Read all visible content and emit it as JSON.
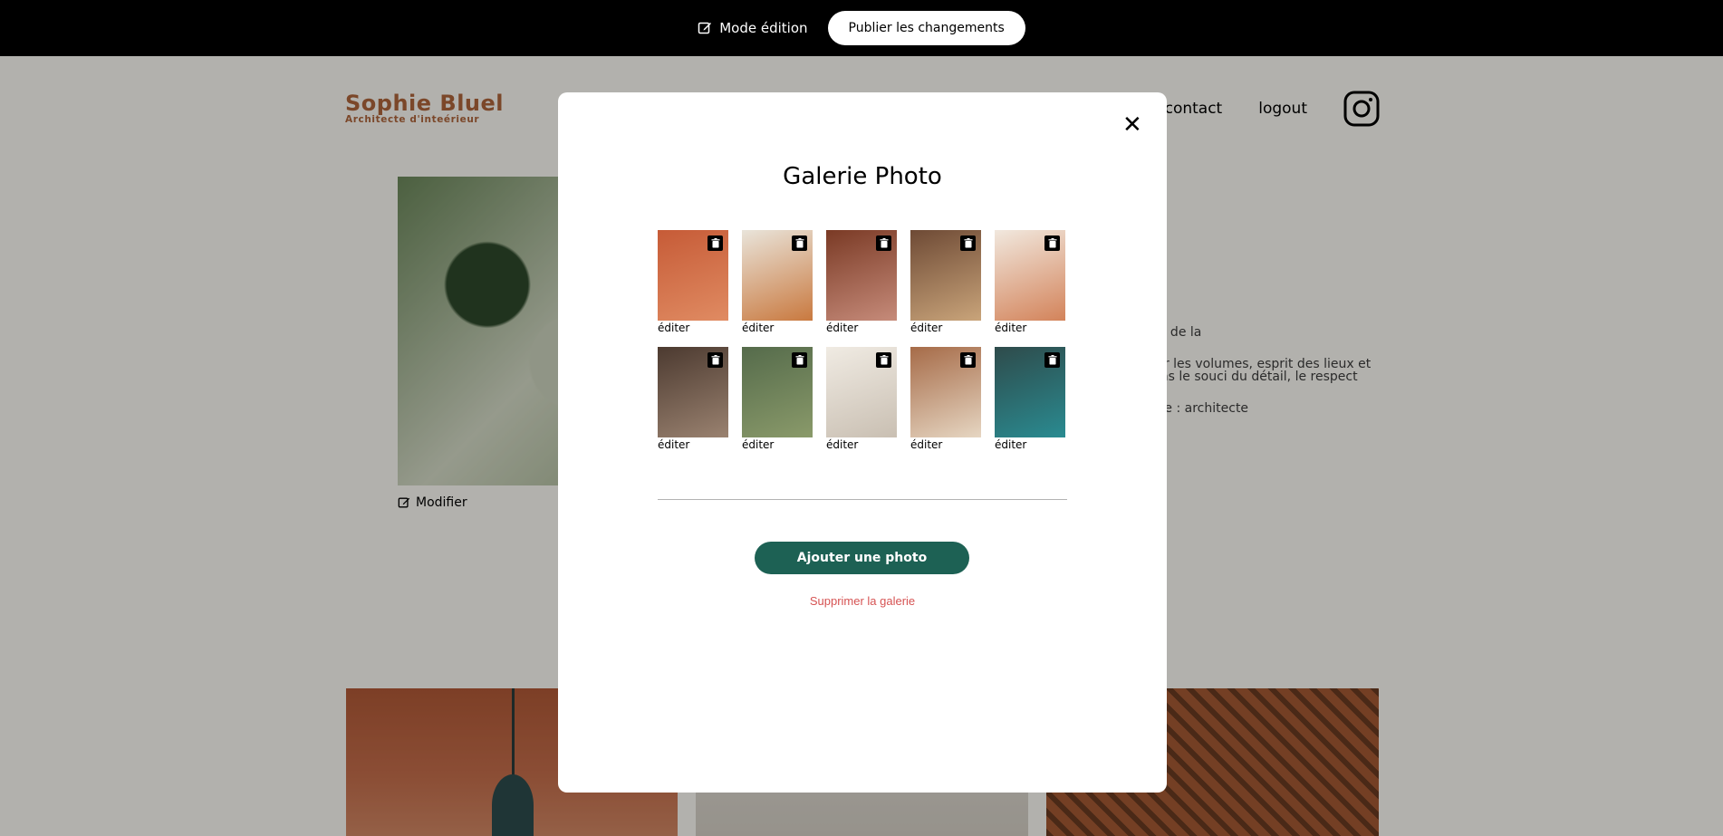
{
  "edit_bar": {
    "mode_label": "Mode édition",
    "publish_label": "Publier les changements"
  },
  "header": {
    "logo_name": "Sophie Bluel",
    "logo_subtitle": "Architecte d'inteérieur",
    "nav": [
      "contact",
      "logout"
    ]
  },
  "intro": {
    "modify_label": "Modifier",
    "paragraphs": [
      "vous accompagne de la",
      "à mettre en valeur les volumes, esprit des lieux et le choix adapté ans le souci du détail, le respect",
      "eut-être constituée : architecte"
    ]
  },
  "modal": {
    "title": "Galerie Photo",
    "edit_label": "éditer",
    "add_button": "Ajouter une photo",
    "delete_gallery": "Supprimer la galerie",
    "thumbnails": [
      {
        "name": "suspension-lamp",
        "colors": [
          "#c65b37",
          "#e08b62"
        ]
      },
      {
        "name": "living-room",
        "colors": [
          "#e9e4da",
          "#c9793f"
        ]
      },
      {
        "name": "greenhouse-restaurant",
        "colors": [
          "#7a3a25",
          "#c68b7a"
        ]
      },
      {
        "name": "wooden-terrace",
        "colors": [
          "#6e4a35",
          "#c9a47a"
        ]
      },
      {
        "name": "arch-shapes",
        "colors": [
          "#f1e8de",
          "#d3835a"
        ]
      },
      {
        "name": "wood-panel-kitchen",
        "colors": [
          "#4c3a30",
          "#9a8270"
        ]
      },
      {
        "name": "green-lounge",
        "colors": [
          "#556b4b",
          "#8a9a6a"
        ]
      },
      {
        "name": "white-alcove",
        "colors": [
          "#f0ebe3",
          "#c9bfb2"
        ]
      },
      {
        "name": "terracotta-bar",
        "colors": [
          "#a66b48",
          "#e6d6c2"
        ]
      },
      {
        "name": "blue-bar",
        "colors": [
          "#2e4b4b",
          "#2a8b91"
        ]
      }
    ]
  }
}
